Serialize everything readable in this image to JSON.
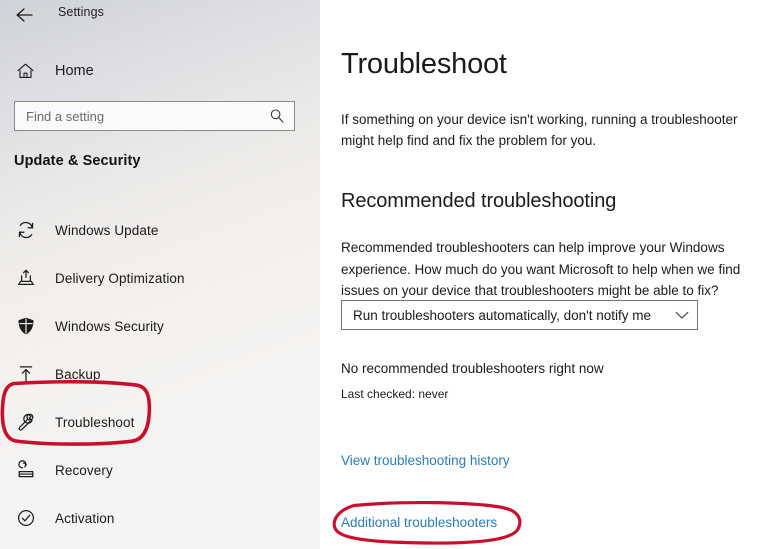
{
  "window": {
    "title": "Settings",
    "back_icon": "back-arrow-icon"
  },
  "sidebar": {
    "home": {
      "label": "Home",
      "icon": "home-icon"
    },
    "search": {
      "value": "",
      "placeholder": "Find a setting",
      "icon": "search-icon"
    },
    "section_heading": "Update & Security",
    "items": [
      {
        "label": "Windows Update",
        "icon": "sync-icon",
        "selected": false
      },
      {
        "label": "Delivery Optimization",
        "icon": "upload-box-icon",
        "selected": false
      },
      {
        "label": "Windows Security",
        "icon": "shield-icon",
        "selected": false
      },
      {
        "label": "Backup",
        "icon": "upload-arrow-icon",
        "selected": false
      },
      {
        "label": "Troubleshoot",
        "icon": "wrench-icon",
        "selected": true
      },
      {
        "label": "Recovery",
        "icon": "recovery-icon",
        "selected": false
      },
      {
        "label": "Activation",
        "icon": "check-circle-icon",
        "selected": false
      }
    ]
  },
  "main": {
    "page_title": "Troubleshoot",
    "intro": "If something on your device isn't working, running a troubleshooter might help find and fix the problem for you.",
    "subsection": {
      "title": "Recommended troubleshooting",
      "body": "Recommended troubleshooters can help improve your Windows experience. How much do you want Microsoft to help when we find issues on your device that troubleshooters might be able to fix?",
      "dropdown": {
        "value": "Run troubleshooters automatically, don't notify me",
        "chevron_icon": "chevron-down-icon"
      },
      "status_main": "No recommended troubleshooters right now",
      "status_sub": "Last checked: never"
    },
    "links": [
      {
        "label": "View troubleshooting history"
      },
      {
        "label": "Additional troubleshooters"
      }
    ]
  },
  "annotations": [
    {
      "name": "sidebar-troubleshoot-highlight",
      "shape": "rounded-rect",
      "color": "#c8102e"
    },
    {
      "name": "additional-troubleshooters-highlight",
      "shape": "ellipse",
      "color": "#c8102e"
    }
  ],
  "colors": {
    "accent_link": "#2b7cb8",
    "annotation_red": "#c8102e",
    "text_primary": "#1b1b1b",
    "sidebar_bg": "#f1f0ef"
  }
}
